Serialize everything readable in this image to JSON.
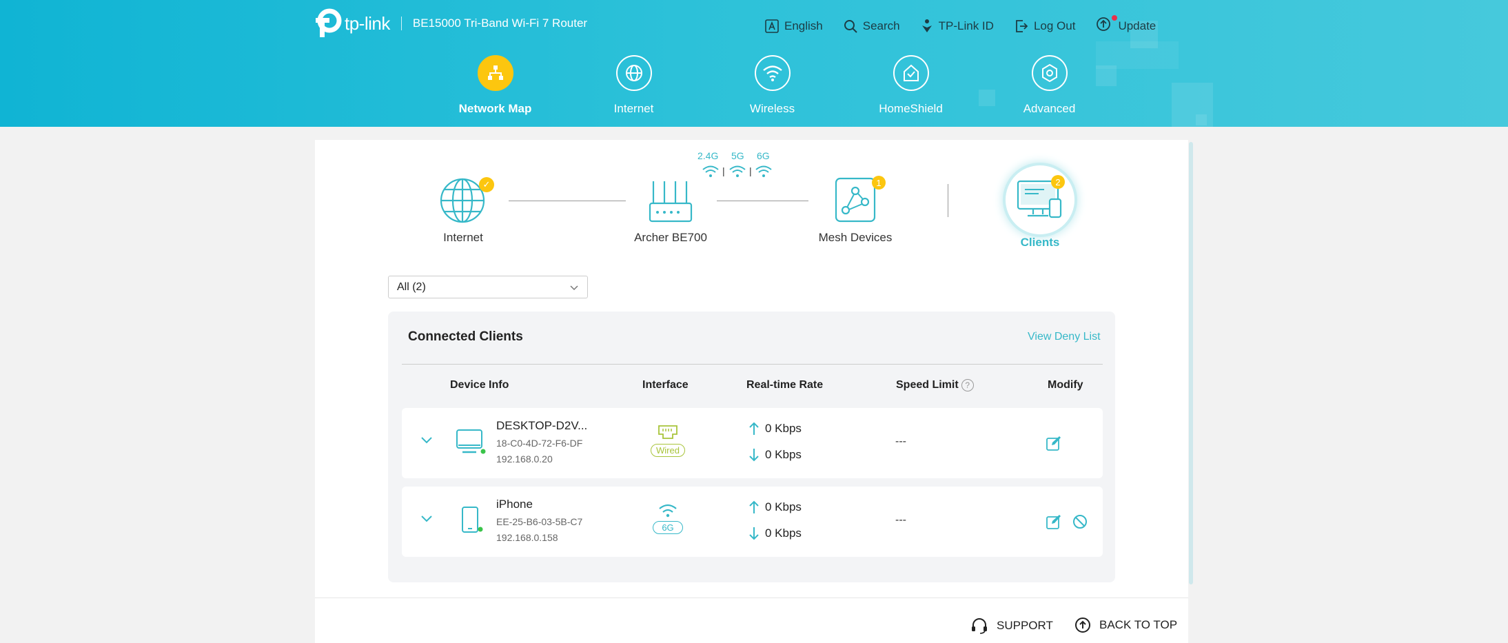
{
  "header": {
    "brand": "tp-link",
    "model": "BE15000 Tri-Band Wi-Fi 7 Router",
    "links": [
      {
        "label": "English",
        "icon": "language-icon"
      },
      {
        "label": "Search",
        "icon": "search-icon"
      },
      {
        "label": "TP-Link ID",
        "icon": "tplink-id-icon"
      },
      {
        "label": "Log Out",
        "icon": "logout-icon"
      },
      {
        "label": "Update",
        "icon": "update-icon"
      }
    ],
    "nav": [
      {
        "label": "Network Map",
        "active": true
      },
      {
        "label": "Internet"
      },
      {
        "label": "Wireless"
      },
      {
        "label": "HomeShield"
      },
      {
        "label": "Advanced"
      }
    ]
  },
  "topology": {
    "nodes": [
      {
        "label": "Internet"
      },
      {
        "label": "Archer BE700"
      },
      {
        "label": "Mesh Devices",
        "badge": "1"
      },
      {
        "label": "Clients",
        "badge": "2",
        "active": true
      }
    ],
    "bands": [
      "2.4G",
      "5G",
      "6G"
    ]
  },
  "filter": {
    "value": "All (2)"
  },
  "clients": {
    "title": "Connected Clients",
    "deny_link": "View Deny List",
    "columns": [
      "Device Info",
      "Interface",
      "Real-time Rate",
      "Speed Limit",
      "Modify"
    ],
    "rows": [
      {
        "name": "DESKTOP-D2V...",
        "mac": "18-C0-4D-72-F6-DF",
        "ip": "192.168.0.20",
        "interface": "Wired",
        "up": "0 Kbps",
        "down": "0 Kbps",
        "limit": "---"
      },
      {
        "name": "iPhone",
        "mac": "EE-25-B6-03-5B-C7",
        "ip": "192.168.0.158",
        "interface": "6G",
        "up": "0 Kbps",
        "down": "0 Kbps",
        "limit": "---"
      }
    ]
  },
  "footer": {
    "support": "SUPPORT",
    "back_to_top": "BACK TO TOP"
  },
  "colors": {
    "accent": "#36b8c8",
    "active_nav": "#fcc60f",
    "wired": "#a8c43a",
    "online": "#3ac44a"
  }
}
